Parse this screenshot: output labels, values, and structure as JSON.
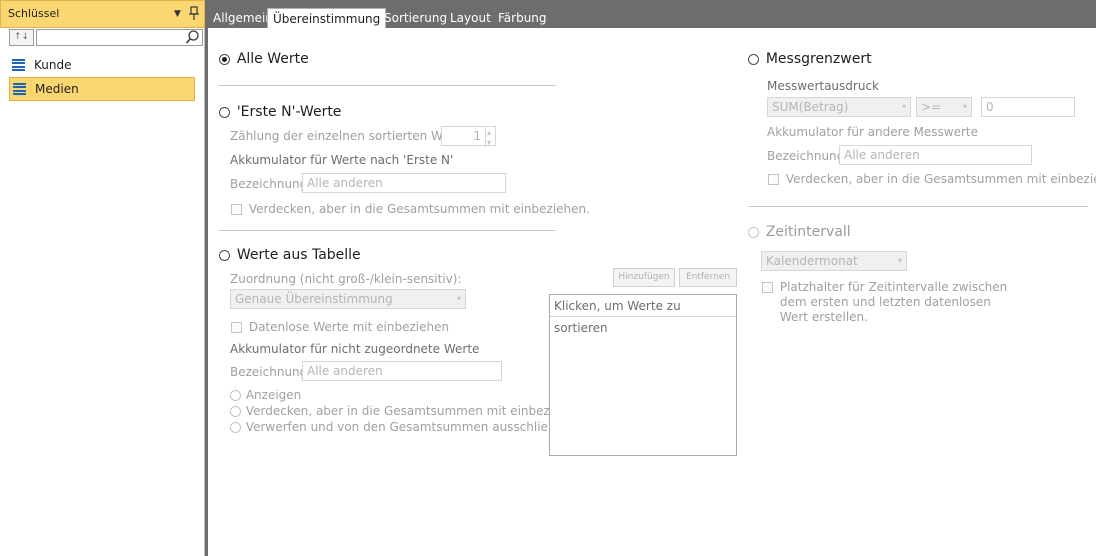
{
  "left_pane": {
    "title": "Schlüssel",
    "sort_toggle": "↑↓",
    "search_placeholder": "",
    "items": [
      {
        "label": "Kunde",
        "selected": false
      },
      {
        "label": "Medien",
        "selected": true
      }
    ]
  },
  "tabs": [
    {
      "label": "Allgemein",
      "active": false
    },
    {
      "label": "Übereinstimmung",
      "active": true
    },
    {
      "label": "Sortierung",
      "active": false
    },
    {
      "label": "Layout",
      "active": false
    },
    {
      "label": "Färbung",
      "active": false
    }
  ],
  "all_values": {
    "label": "Alle Werte",
    "selected": true
  },
  "top_n": {
    "label": "'Erste N'-Werte",
    "count_label": "Zählung der einzelnen sortierten Werte:",
    "count_value": "1",
    "accumulator_label": "Akkumulator für Werte nach 'Erste N'",
    "designation_label": "Bezeichnung:",
    "designation_value": "Alle anderen",
    "hide_label": "Verdecken, aber in die Gesamtsummen mit einbeziehen."
  },
  "from_table": {
    "label": "Werte aus Tabelle",
    "mapping_label": "Zuordnung (nicht groß-/klein-sensitiv):",
    "mapping_value": "Genaue Übereinstimmung",
    "include_dataless": "Datenlose Werte mit einbeziehen",
    "accumulator_label": "Akkumulator für nicht zugeordnete Werte",
    "designation_label": "Bezeichnung:",
    "designation_value": "Alle anderen",
    "options": [
      "Anzeigen",
      "Verdecken, aber in die Gesamtsummen mit einbeziehen.",
      "Verwerfen und von den Gesamtsummen ausschließen"
    ],
    "add_button": "Hinzufügen",
    "remove_button": "Entfernen",
    "list_header": "Klicken, um Werte zu sortieren"
  },
  "measure_threshold": {
    "label": "Messgrenzwert",
    "expression_label": "Messwertausdruck",
    "expression_value": "SUM(Betrag)",
    "operator_value": ">=",
    "threshold_value": "0",
    "accumulator_label": "Akkumulator für andere Messwerte",
    "designation_label": "Bezeichnung:",
    "designation_value": "Alle anderen",
    "hide_label": "Verdecken, aber in die Gesamtsummen mit einbeziehen."
  },
  "time_interval": {
    "label": "Zeitintervall",
    "interval_value": "Kalendermonat",
    "placeholder_line1": "Platzhalter für Zeitintervalle zwischen",
    "placeholder_line2": "dem ersten und letzten datenlosen",
    "placeholder_line3": "Wert erstellen."
  },
  "colors": {
    "accent": "#fbd771",
    "tab_strip": "#6d6d6d",
    "list_icon": "#1f64b5"
  }
}
